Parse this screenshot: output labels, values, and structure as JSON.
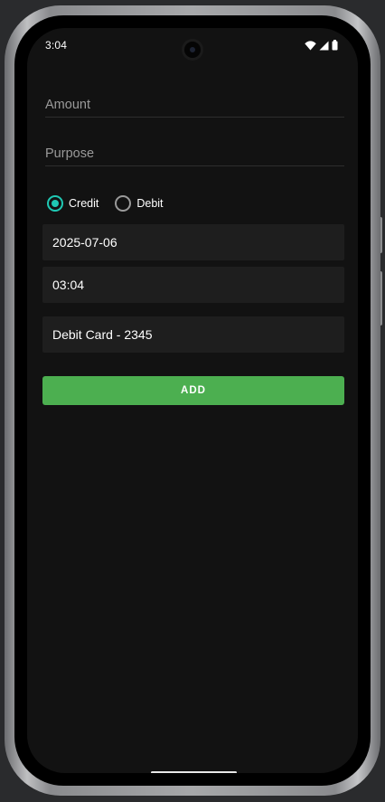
{
  "status_bar": {
    "time": "3:04",
    "icons": [
      "wifi-icon",
      "cellular-signal-icon",
      "battery-icon"
    ]
  },
  "form": {
    "amount_placeholder": "Amount",
    "purpose_placeholder": "Purpose",
    "transaction_type": {
      "options": [
        "Credit",
        "Debit"
      ],
      "selected": "Credit"
    },
    "date_value": "2025-07-06",
    "time_value": "03:04",
    "payment_method": "Debit Card - 2345",
    "add_button_label": "ADD"
  },
  "colors": {
    "background": "#121212",
    "field_background": "#1e1e1e",
    "accent_radio": "#1fc8b3",
    "button": "#4caf50"
  }
}
